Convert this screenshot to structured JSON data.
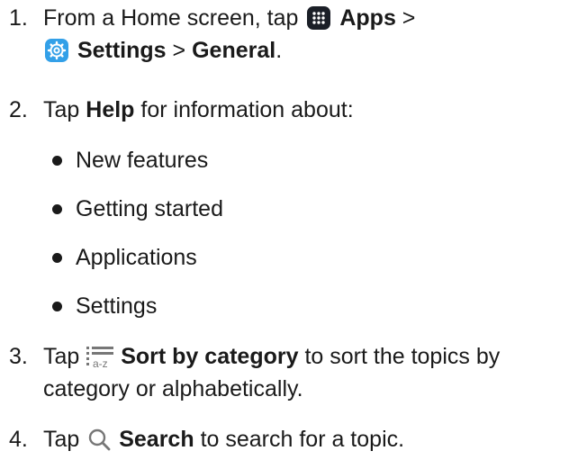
{
  "steps": [
    {
      "num": "1.",
      "line1_pre": "From a Home screen, tap",
      "apps": "Apps",
      "sep1": ">",
      "settings": "Settings",
      "sep2": ">",
      "general": "General",
      "end": "."
    },
    {
      "num": "2.",
      "pre": "Tap",
      "help": "Help",
      "post": "for information about:"
    },
    {
      "num": "3.",
      "pre": "Tap",
      "sort": "Sort by category",
      "post": "to sort the topics by",
      "line2": "category or alphabetically."
    },
    {
      "num": "4.",
      "pre": "Tap",
      "search": "Search",
      "post": "to search for a topic."
    }
  ],
  "bullets": [
    "New features",
    "Getting started",
    "Applications",
    "Settings"
  ],
  "icons": {
    "apps": "apps-grid-icon",
    "settings": "settings-gear-icon",
    "sort": "sort-list-a-z-icon",
    "search": "magnifier-search-icon"
  },
  "colors": {
    "text": "#1a1a1a",
    "apps_icon_bg": "#1b1f27",
    "settings_icon_bg": "#33a0e8",
    "sort_icon": "#777777",
    "search_icon": "#777777"
  }
}
